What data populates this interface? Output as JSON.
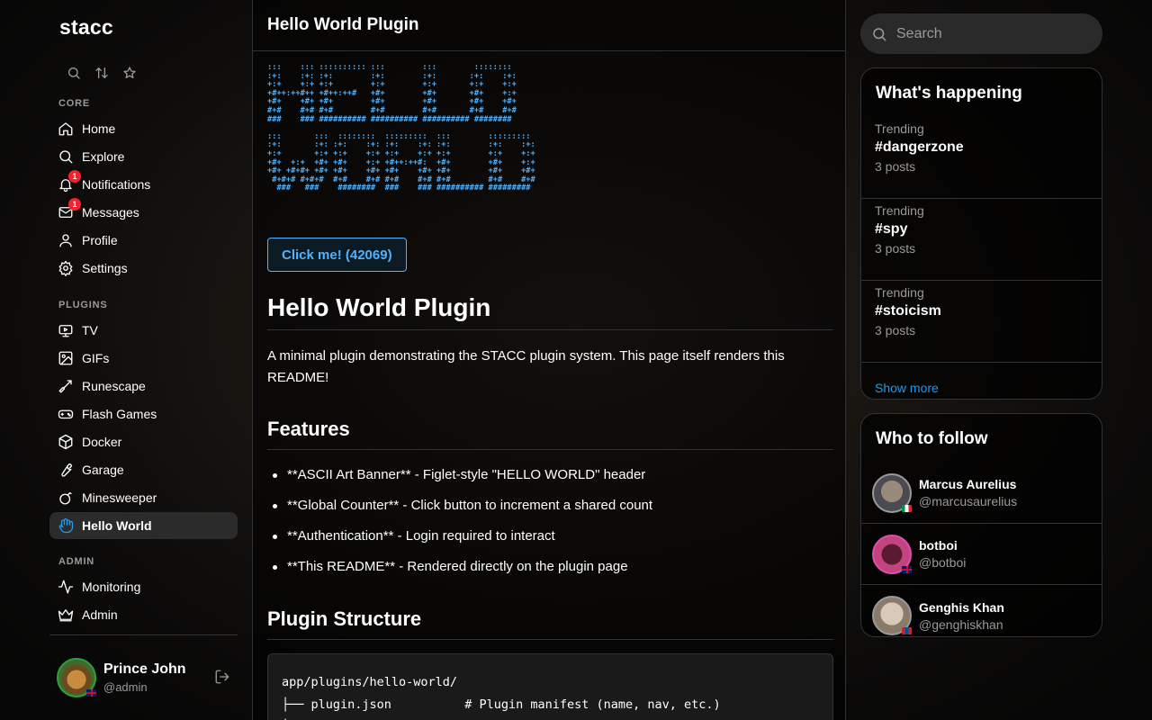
{
  "app": {
    "logo": "stacc"
  },
  "sidebar": {
    "quick_icons": [
      "search-icon",
      "sort-icon",
      "star-icon"
    ],
    "sections": {
      "core": "CORE",
      "plugins": "PLUGINS",
      "admin": "ADMIN"
    },
    "core_items": [
      {
        "label": "Home",
        "icon": "home-icon"
      },
      {
        "label": "Explore",
        "icon": "search-icon"
      },
      {
        "label": "Notifications",
        "icon": "bell-icon",
        "badge": "1"
      },
      {
        "label": "Messages",
        "icon": "mail-icon",
        "badge": "1"
      },
      {
        "label": "Profile",
        "icon": "user-icon"
      },
      {
        "label": "Settings",
        "icon": "gear-icon"
      }
    ],
    "plugin_items": [
      {
        "label": "TV",
        "icon": "tv-icon"
      },
      {
        "label": "GIFs",
        "icon": "image-icon"
      },
      {
        "label": "Runescape",
        "icon": "sword-icon"
      },
      {
        "label": "Flash Games",
        "icon": "gamepad-icon"
      },
      {
        "label": "Docker",
        "icon": "box-icon"
      },
      {
        "label": "Garage",
        "icon": "wrench-icon"
      },
      {
        "label": "Minesweeper",
        "icon": "bomb-icon"
      },
      {
        "label": "Hello World",
        "icon": "hand-icon",
        "active": true
      }
    ],
    "admin_items": [
      {
        "label": "Monitoring",
        "icon": "activity-icon"
      },
      {
        "label": "Admin",
        "icon": "crown-icon"
      }
    ],
    "user": {
      "name": "Prince John",
      "handle": "@admin"
    }
  },
  "main": {
    "header": "Hello World Plugin",
    "ascii_art": ":::    ::: :::::::::: :::        :::        ::::::::\n:+:    :+: :+:        :+:        :+:       :+:    :+:\n+:+    +:+ +:+        +:+        +:+       +:+    +:+\n+#++:++#++ +#++:++#   +#+        +#+       +#+    +:+\n+#+    +#+ +#+        +#+        +#+       +#+    +#+\n#+#    #+# #+#        #+#        #+#       #+#    #+#\n###    ### ########## ########## ########## ########\n\n:::       :::  ::::::::  :::::::::  :::        :::::::::\n:+:       :+: :+:    :+: :+:    :+: :+:        :+:    :+:\n+:+       +:+ +:+    +:+ +:+    +:+ +:+        +:+    +:+\n+#+  +:+  +#+ +#+    +:+ +#++:++#:  +#+        +#+    +:+\n+#+ +#+#+ +#+ +#+    +#+ +#+    +#+ +#+        +#+    +#+\n #+#+# #+#+#  #+#    #+# #+#    #+# #+#        #+#    #+#\n  ###   ###    ########  ###    ### ########## #########",
    "counter_button": "Click me! (42069)",
    "readme": {
      "h1": "Hello World Plugin",
      "intro": "A minimal plugin demonstrating the STACC plugin system. This page itself renders this README!",
      "features_heading": "Features",
      "features": [
        "**ASCII Art Banner** - Figlet-style \"HELLO WORLD\" header",
        "**Global Counter** - Click button to increment a shared count",
        "**Authentication** - Login required to interact",
        "**This README** - Rendered directly on the plugin page"
      ],
      "structure_heading": "Plugin Structure",
      "code": "app/plugins/hello-world/\n├── plugin.json          # Plugin manifest (name, nav, etc.)\n├── README.md            # This file (rendered on page)"
    }
  },
  "right": {
    "search_placeholder": "Search",
    "trending": {
      "title": "What's happening",
      "items": [
        {
          "category": "Trending",
          "tag": "#dangerzone",
          "count": "3 posts"
        },
        {
          "category": "Trending",
          "tag": "#spy",
          "count": "3 posts"
        },
        {
          "category": "Trending",
          "tag": "#stoicism",
          "count": "3 posts"
        }
      ],
      "show_more": "Show more"
    },
    "follow": {
      "title": "Who to follow",
      "items": [
        {
          "name": "Marcus Aurelius",
          "handle": "@marcusaurelius"
        },
        {
          "name": "botboi",
          "handle": "@botboi"
        },
        {
          "name": "Genghis Khan",
          "handle": "@genghiskhan"
        }
      ]
    }
  },
  "colors": {
    "accent": "#1d9bf0",
    "ascii": "#4fb3ff",
    "badge": "#f4212e"
  }
}
